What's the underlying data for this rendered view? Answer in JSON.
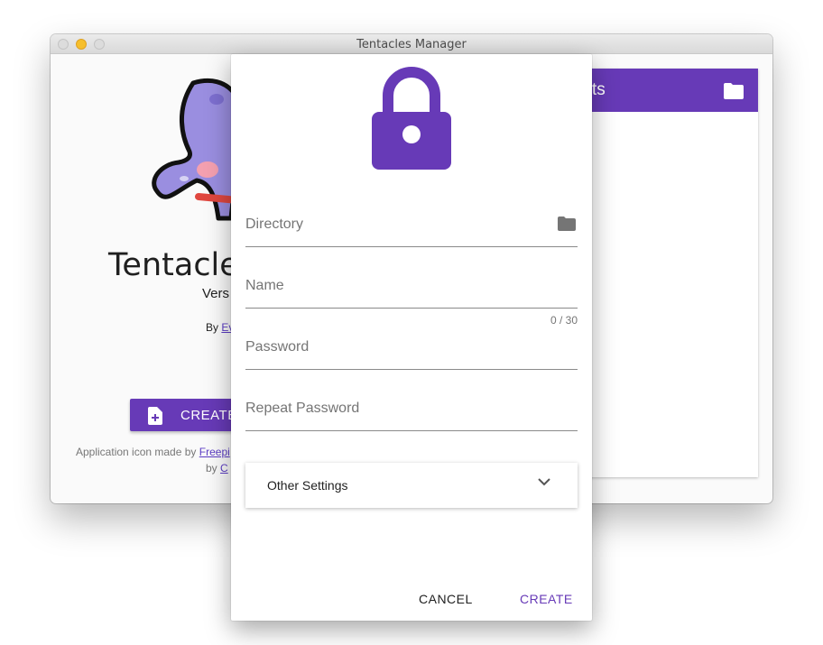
{
  "window": {
    "title": "Tentacles Manager"
  },
  "main": {
    "app_title": "Tentacles",
    "version": "Vers",
    "by_prefix": "By",
    "by_link": "Ev",
    "create_button": "CREATE",
    "credit_prefix": "Application icon made by",
    "credit_link": "Freepi",
    "credit_by": "by",
    "credit_link2": "C"
  },
  "right_panel": {
    "header": "ts"
  },
  "dialog": {
    "directory_placeholder": "Directory",
    "name_placeholder": "Name",
    "name_counter": "0 / 30",
    "password_placeholder": "Password",
    "repeat_password_placeholder": "Repeat Password",
    "other_settings": "Other Settings",
    "cancel_label": "CANCEL",
    "create_label": "CREATE"
  },
  "colors": {
    "accent": "#673ab7",
    "folder_icon": "#757575"
  },
  "icons": [
    "lock-icon",
    "folder-icon",
    "chevron-down-icon",
    "document-add-icon",
    "octopus-logo"
  ]
}
